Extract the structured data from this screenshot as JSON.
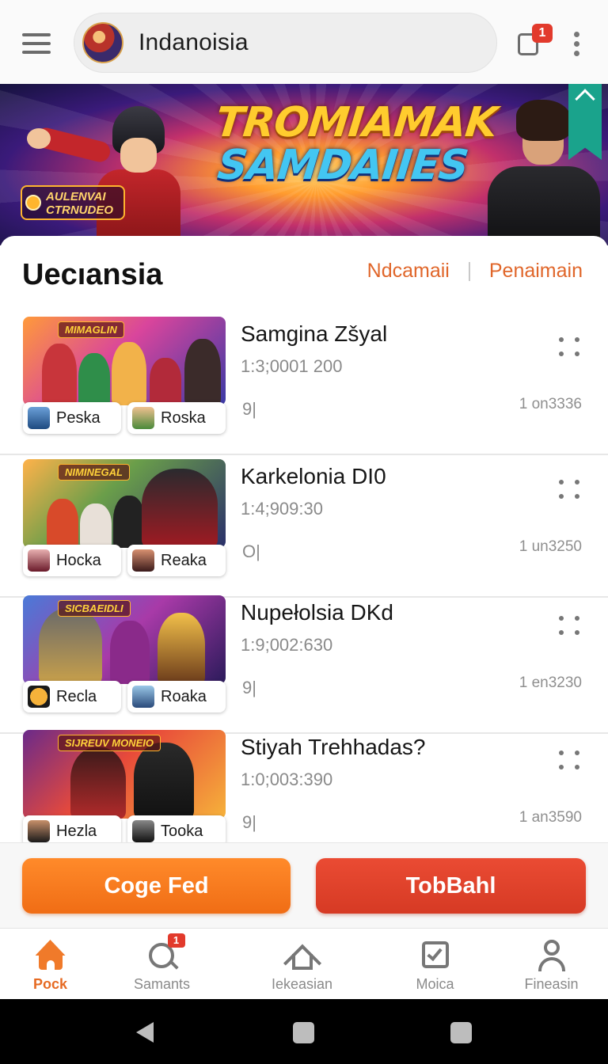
{
  "header": {
    "title": "Indanoisia",
    "notification_count": "1",
    "icons": [
      "menu-icon",
      "avatar",
      "notification-icon",
      "more-vertical-icon"
    ]
  },
  "banner": {
    "title_line1": "TROMIAMAK",
    "title_line2": "SAMDAIIES",
    "sub_line1": "AULENVAI",
    "sub_line2": "CTRNUDEO",
    "colors": {
      "title_gold": "#ffcc2e",
      "title_blue": "#43c6f2",
      "tag": "#1aa38c"
    }
  },
  "section": {
    "title": "Uecıansia",
    "link1": "Ndcamaii",
    "link2": "Penaimain"
  },
  "items": [
    {
      "title": "Samgina Zšyal",
      "code": "1:3;0001 200",
      "small": "9|",
      "meta": "1 on3336",
      "thumb_badge": "MIMAGLIN",
      "chip_a": "Peska",
      "chip_b": "Roska"
    },
    {
      "title": "Karkelonia DI0",
      "code": "1:4;909:30",
      "small": "O|",
      "meta": "1 un3250",
      "thumb_badge": "NIMINEGAL",
      "chip_a": "Hocka",
      "chip_b": "Reaka"
    },
    {
      "title": "Nupełolsia DKd",
      "code": "1:9;002:630",
      "small": "9|",
      "meta": "1 en3230",
      "thumb_badge": "SICBAEIDLI",
      "chip_a": "Recla",
      "chip_b": "Roaka"
    },
    {
      "title": "Stiyah Trehhadas?",
      "code": "1:0;003:390",
      "small": "9|",
      "meta": "1 an3590",
      "thumb_badge": "SIJREUV MONEIO",
      "chip_a": "Hezla",
      "chip_b": "Tooka"
    }
  ],
  "actions": {
    "primary": "Coge Fed",
    "secondary": "TobBahl",
    "colors": {
      "primary": "#f57a22",
      "secondary": "#e0432d"
    }
  },
  "bottom_nav": [
    {
      "label": "Pock",
      "icon": "home-icon",
      "active": true
    },
    {
      "label": "Samants",
      "icon": "search-icon",
      "badge": "1"
    },
    {
      "label": "Iekeasian",
      "icon": "home-outline-icon"
    },
    {
      "label": "Moica",
      "icon": "checkbox-icon"
    },
    {
      "label": "Fineasin",
      "icon": "user-icon"
    }
  ],
  "accent_color": "#e66a22"
}
